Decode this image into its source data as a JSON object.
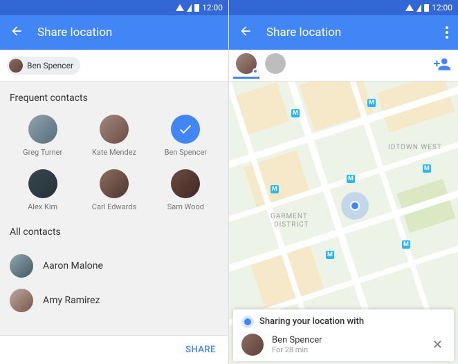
{
  "status": {
    "time": "12:00"
  },
  "left": {
    "appbar": {
      "title": "Share location"
    },
    "chip": {
      "name": "Ben Spencer"
    },
    "frequent_title": "Frequent contacts",
    "frequent": [
      {
        "name": "Greg Turner",
        "selected": false
      },
      {
        "name": "Kate Mendez",
        "selected": false
      },
      {
        "name": "Ben Spencer",
        "selected": true
      },
      {
        "name": "Alex Kim",
        "selected": false
      },
      {
        "name": "Carl Edwards",
        "selected": false
      },
      {
        "name": "Sam Wood",
        "selected": false
      }
    ],
    "all_title": "All contacts",
    "all": [
      {
        "name": "Aaron Malone"
      },
      {
        "name": "Amy Ramirez"
      }
    ],
    "footer": {
      "share": "SHARE"
    }
  },
  "right": {
    "appbar": {
      "title": "Share location"
    },
    "map_labels": {
      "midtown": "IDTOWN WEST",
      "garment1": "GARMENT",
      "garment2": "DISTRICT",
      "metro": "M"
    },
    "sheet": {
      "heading": "Sharing your location with",
      "name": "Ben Spencer",
      "duration": "For 28 min"
    }
  }
}
